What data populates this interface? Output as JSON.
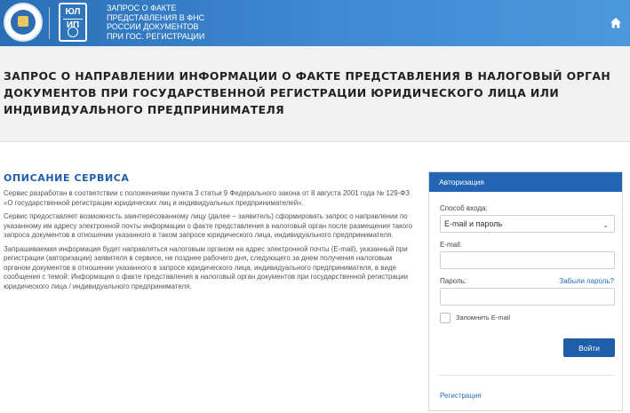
{
  "header": {
    "fns_logo": "fns-emblem",
    "service_logo": {
      "line1": "ЮЛ",
      "line2": "ИП"
    },
    "service_name_lines": [
      "ЗАПРОС О ФАКТЕ",
      "ПРЕДСТАВЛЕНИЯ В ФНС",
      "РОССИИ ДОКУМЕНТОВ",
      "ПРИ ГОС. РЕГИСТРАЦИИ"
    ],
    "home_icon": "home-icon"
  },
  "page_title": "ЗАПРОС О НАПРАВЛЕНИИ ИНФОРМАЦИИ О ФАКТЕ ПРЕДСТАВЛЕНИЯ В НАЛОГОВЫЙ ОРГАН ДОКУМЕНТОВ ПРИ ГОСУДАРСТВЕННОЙ РЕГИСТРАЦИИ ЮРИДИЧЕСКОГО ЛИЦА ИЛИ ИНДИВИДУАЛЬНОГО ПРЕДПРИНИМАТЕЛЯ",
  "description": {
    "heading": "ОПИСАНИЕ СЕРВИСА",
    "paragraphs": [
      "Сервис разработан в соответствии с положениями пункта 3 статьи 9 Федерального закона от 8 августа 2001 года № 129-ФЗ «О государственной регистрации юридических лиц и индивидуальных предпринимателей».",
      "Сервис предоставляет возможность заинтересованному лицу (далее – заявитель) сформировать запрос о направлении по указанному им адресу электронной почты информации о факте представления в налоговый орган после размещения такого запроса документов в отношении указанного в таком запросе юридического лица, индивидуального предпринимателя.",
      "Запрашиваемая информация будет направляться налоговым органом на адрес электронной почты (E-mail), указанный при регистрации (авторизации) заявителя в сервисе, не позднее рабочего дня, следующего за днем получения налоговым органом документов в отношении указанного в запросе юридического лица, индивидуального предпринимателя, в виде сообщения с темой: Информация о факте представления в налоговый орган документов при государственной регистрации юридического лица / индивидуального предпринимателя."
    ]
  },
  "auth": {
    "title": "Авторизация",
    "method_label": "Способ входа:",
    "method_value": "E-mail и пароль",
    "email_label": "E-mail:",
    "email_value": "",
    "password_label": "Пароль:",
    "password_value": "",
    "forgot_link": "Забыли пароль?",
    "remember_label": "Запомнить E-mail",
    "remember_checked": false,
    "login_button": "Войти",
    "register_link": "Регистрация"
  },
  "colors": {
    "header_blue": "#3c86cf",
    "accent_blue": "#1f5fae",
    "panel_head": "#2266b3",
    "title_band": "#f1f1f1"
  }
}
